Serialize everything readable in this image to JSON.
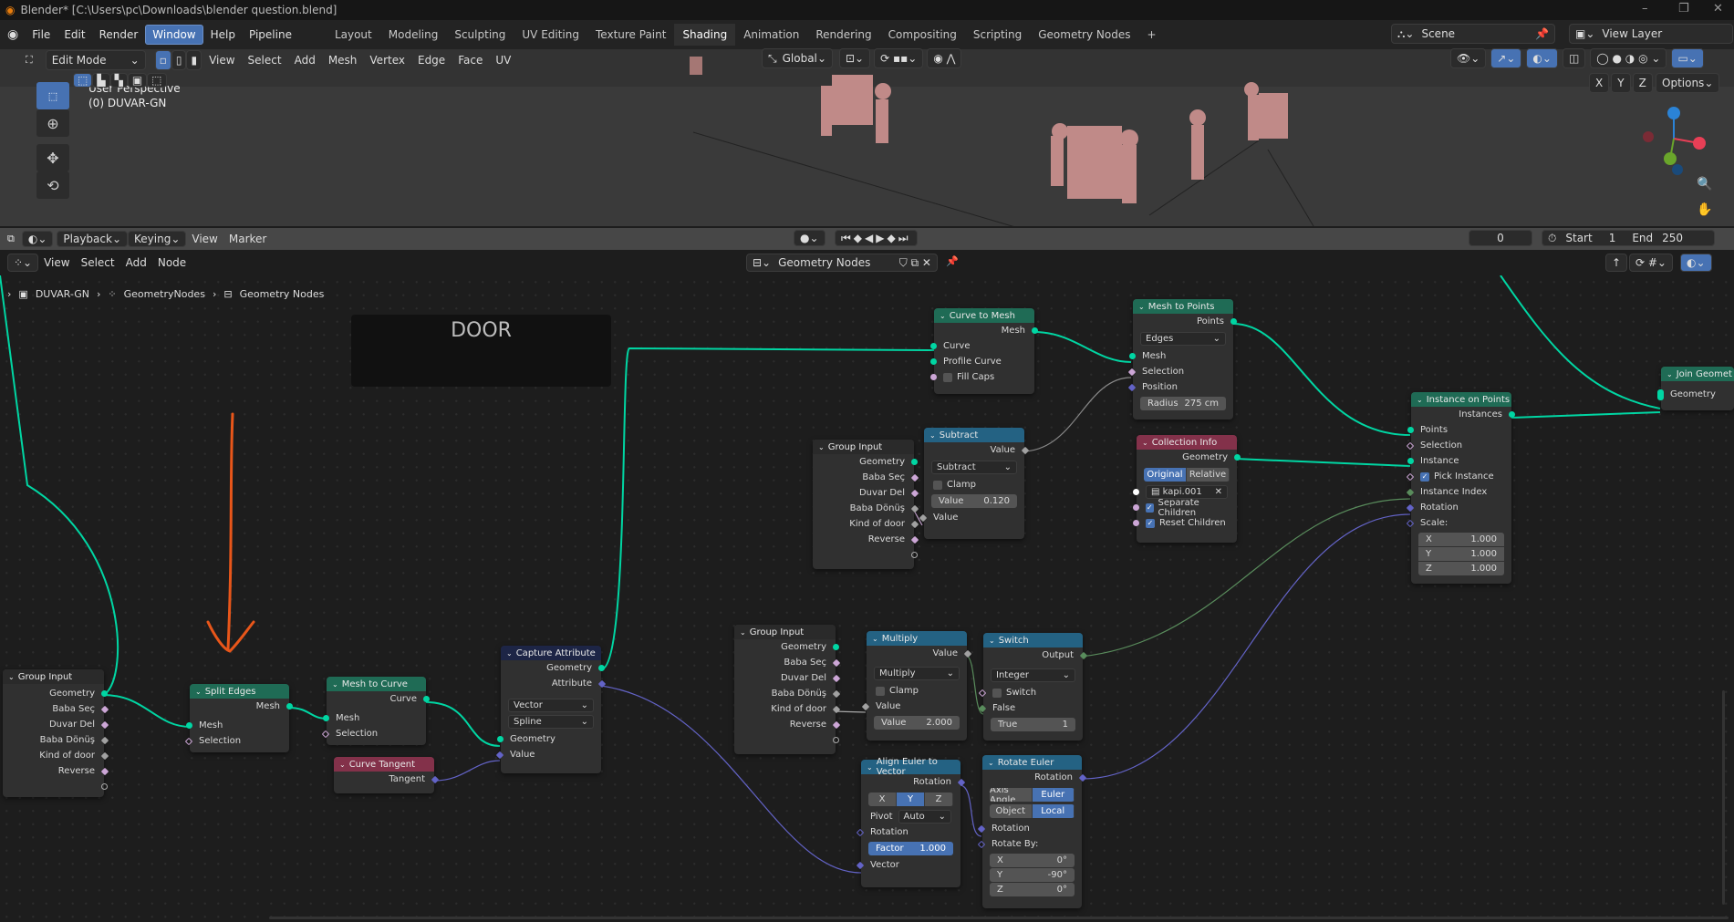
{
  "window": {
    "title": "Blender* [C:\\Users\\pc\\Downloads\\blender question.blend]",
    "controls": [
      "minimize",
      "maximize",
      "close"
    ]
  },
  "menubar": {
    "items": [
      "File",
      "Edit",
      "Render",
      "Window",
      "Help",
      "Pipeline"
    ],
    "active": "Window"
  },
  "workspaces": {
    "tabs": [
      "Layout",
      "Modeling",
      "Sculpting",
      "UV Editing",
      "Texture Paint",
      "Shading",
      "Animation",
      "Rendering",
      "Compositing",
      "Scripting",
      "Geometry Nodes"
    ],
    "active": "Shading",
    "add": "+"
  },
  "scene": {
    "label": "Scene",
    "view_layer": "View Layer"
  },
  "viewport": {
    "mode": "Edit Mode",
    "menus": [
      "View",
      "Select",
      "Add",
      "Mesh",
      "Vertex",
      "Edge",
      "Face",
      "UV"
    ],
    "orientation": "Global",
    "options": "Options",
    "axes": [
      "X",
      "Y",
      "Z"
    ],
    "overlay_title": "User Perspective",
    "overlay_object": "(0) DUVAR-GN"
  },
  "timeline": {
    "menus": [
      "Playback",
      "Keying",
      "View",
      "Marker"
    ],
    "current_frame": "0",
    "start_label": "Start",
    "start": "1",
    "end_label": "End",
    "end": "250"
  },
  "node_editor": {
    "menus": [
      "View",
      "Select",
      "Add",
      "Node"
    ],
    "tree_name": "Geometry Nodes",
    "breadcrumb": [
      "DUVAR-GN",
      "GeometryNodes",
      "Geometry Nodes"
    ],
    "frame_label": "DOOR"
  },
  "nodes": {
    "group_input_1": {
      "title": "Group Input",
      "outputs": [
        "Geometry",
        "Baba Seç",
        "Duvar Del",
        "Baba Dönüş",
        "Kind of door",
        "Reverse"
      ]
    },
    "split_edges": {
      "title": "Split Edges",
      "out": "Mesh",
      "inputs": [
        "Mesh",
        "Selection"
      ]
    },
    "mesh_to_curve": {
      "title": "Mesh to Curve",
      "out": "Curve",
      "inputs": [
        "Mesh",
        "Selection"
      ]
    },
    "curve_tangent": {
      "title": "Curve Tangent",
      "out": "Tangent"
    },
    "capture_attribute": {
      "title": "Capture Attribute",
      "outputs": [
        "Geometry",
        "Attribute"
      ],
      "type": "Vector",
      "domain": "Spline",
      "inputs": [
        "Geometry",
        "Value"
      ]
    },
    "curve_to_mesh": {
      "title": "Curve to Mesh",
      "out": "Mesh",
      "inputs": [
        "Curve",
        "Profile Curve"
      ],
      "fill_caps": "Fill Caps"
    },
    "mesh_to_points": {
      "title": "Mesh to Points",
      "out": "Points",
      "mode": "Edges",
      "inputs": [
        "Mesh",
        "Selection",
        "Position"
      ],
      "radius_label": "Radius",
      "radius": "275 cm"
    },
    "group_input_2": {
      "title": "Group Input",
      "outputs": [
        "Geometry",
        "Baba Seç",
        "Duvar Del",
        "Baba Dönüş",
        "Kind of door",
        "Reverse"
      ]
    },
    "subtract": {
      "title": "Subtract",
      "out": "Value",
      "operation": "Subtract",
      "clamp": "Clamp",
      "value_label": "Value",
      "value": "0.120",
      "in": "Value"
    },
    "collection_info": {
      "title": "Collection Info",
      "out": "Geometry",
      "modes": [
        "Original",
        "Relative"
      ],
      "collection": "kapi.001",
      "separate": "Separate Children",
      "reset": "Reset Children"
    },
    "instance_on_points": {
      "title": "Instance on Points",
      "out": "Instances",
      "inputs": [
        "Points",
        "Selection",
        "Instance",
        "Pick Instance",
        "Instance Index",
        "Rotation",
        "Scale:"
      ],
      "scale": [
        {
          "axis": "X",
          "value": "1.000"
        },
        {
          "axis": "Y",
          "value": "1.000"
        },
        {
          "axis": "Z",
          "value": "1.000"
        }
      ]
    },
    "join_geometry": {
      "title": "Join Geomet",
      "in": "Geometry"
    },
    "group_input_3": {
      "title": "Group Input",
      "outputs": [
        "Geometry",
        "Baba Seç",
        "Duvar Del",
        "Baba Dönüş",
        "Kind of door",
        "Reverse"
      ]
    },
    "multiply": {
      "title": "Multiply",
      "out": "Value",
      "operation": "Multiply",
      "clamp": "Clamp",
      "in": "Value",
      "value_label": "Value",
      "value": "2.000"
    },
    "switch": {
      "title": "Switch",
      "out": "Output",
      "type": "Integer",
      "switch": "Switch",
      "false": "False",
      "true_label": "True",
      "true": "1"
    },
    "align_euler": {
      "title": "Align Euler to Vector",
      "out": "Rotation",
      "axes": [
        "X",
        "Y",
        "Z"
      ],
      "axis_active": "Y",
      "pivot_label": "Pivot",
      "pivot": "Auto",
      "rotation": "Rotation",
      "factor_label": "Factor",
      "factor": "1.000",
      "vector": "Vector"
    },
    "rotate_euler": {
      "title": "Rotate Euler",
      "out": "Rotation",
      "type": [
        "Axis Angle",
        "Euler"
      ],
      "space": [
        "Object",
        "Local"
      ],
      "rotation": "Rotation",
      "rotate_by": "Rotate By:",
      "values": [
        {
          "axis": "X",
          "value": "0°"
        },
        {
          "axis": "Y",
          "value": "-90°"
        },
        {
          "axis": "Z",
          "value": "0°"
        }
      ]
    }
  },
  "colors": {
    "geometry": "#00d6a3",
    "accent": "#4772b3",
    "annotation": "#e8561a"
  }
}
